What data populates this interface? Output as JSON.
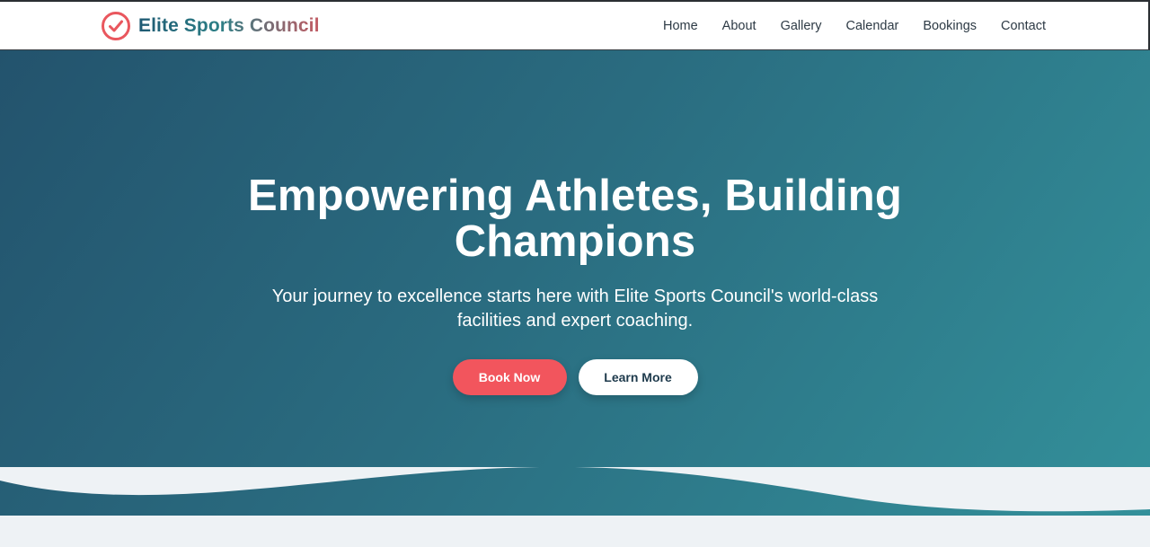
{
  "brand": {
    "name": "Elite Sports Council",
    "icon": "check-circle-icon",
    "colors": {
      "primary": "#1f5a73",
      "accent": "#f2555d"
    }
  },
  "nav": {
    "items": [
      {
        "label": "Home"
      },
      {
        "label": "About"
      },
      {
        "label": "Gallery"
      },
      {
        "label": "Calendar"
      },
      {
        "label": "Bookings"
      },
      {
        "label": "Contact"
      }
    ]
  },
  "hero": {
    "title": "Empowering Athletes, Building Champions",
    "subtitle": "Your journey to excellence starts here with Elite Sports Council's world-class facilities and expert coaching.",
    "primary_button": "Book Now",
    "secondary_button": "Learn More",
    "gradient": {
      "from": "#23536d",
      "to": "#33909a"
    },
    "wave_color": "#eef2f5"
  }
}
